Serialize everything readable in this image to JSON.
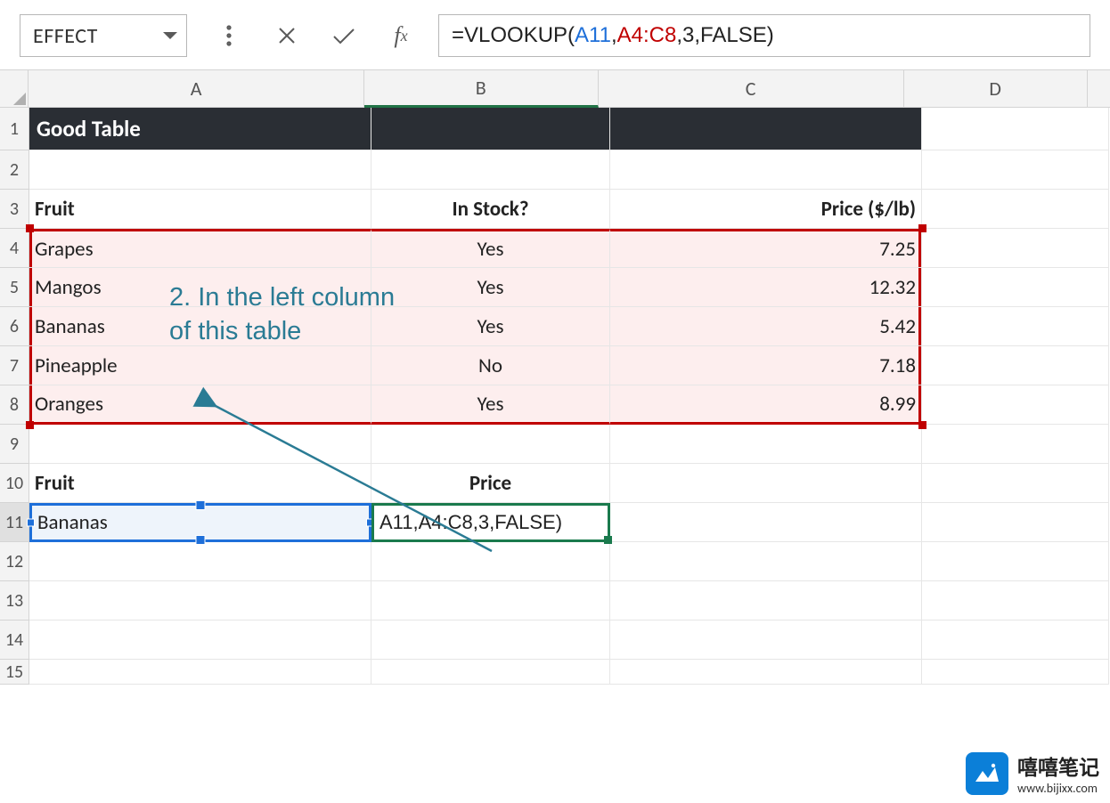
{
  "formula_bar": {
    "name_box": "EFFECT",
    "formula_prefix": "=VLOOKUP(",
    "formula_arg1": "A11",
    "formula_arg2": "A4:C8",
    "formula_rest": ",3,FALSE)"
  },
  "columns": [
    "A",
    "B",
    "C",
    "D"
  ],
  "row_numbers": [
    "1",
    "2",
    "3",
    "4",
    "5",
    "6",
    "7",
    "8",
    "9",
    "10",
    "11",
    "12",
    "13",
    "14",
    "15"
  ],
  "cells": {
    "title": "Good Table",
    "r3": {
      "A": "Fruit",
      "B": "In Stock?",
      "C": "Price ($/lb)"
    },
    "r4": {
      "A": "Grapes",
      "B": "Yes",
      "C": "7.25"
    },
    "r5": {
      "A": "Mangos",
      "B": "Yes",
      "C": "12.32"
    },
    "r6": {
      "A": "Bananas",
      "B": "Yes",
      "C": "5.42"
    },
    "r7": {
      "A": "Pineapple",
      "B": "No",
      "C": "7.18"
    },
    "r8": {
      "A": "Oranges",
      "B": "Yes",
      "C": "8.99"
    },
    "r10": {
      "A": "Fruit",
      "B": "Price"
    },
    "r11": {
      "A": "Bananas",
      "B": "A11,A4:C8,3,FALSE)"
    }
  },
  "annotation": "2. In the left column of this table",
  "watermark": {
    "title": "嘻嘻笔记",
    "url": "www.bijixx.com"
  }
}
